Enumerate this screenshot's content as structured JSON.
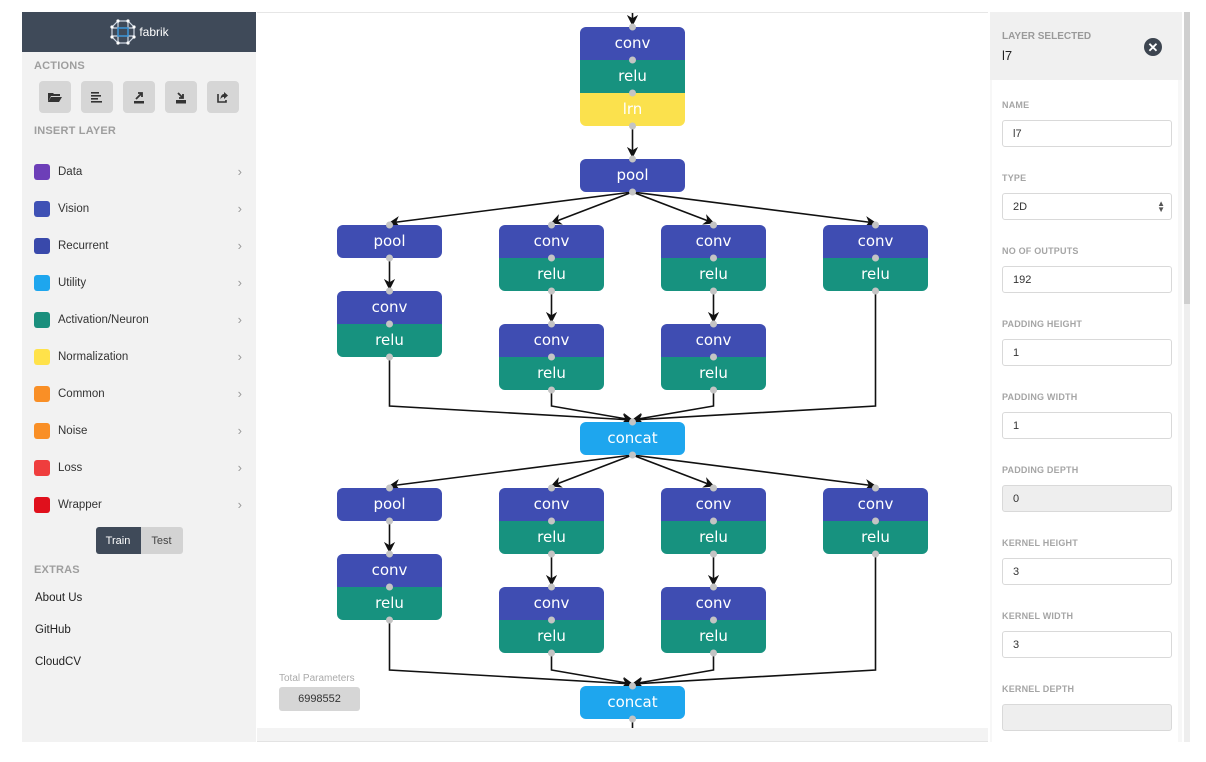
{
  "app": {
    "brand": "fabrik"
  },
  "sidebar": {
    "actions_title": "ACTIONS",
    "actions": [
      {
        "name": "open-icon",
        "tooltip": "open"
      },
      {
        "name": "list-icon",
        "tooltip": "list"
      },
      {
        "name": "export-icon",
        "tooltip": "export"
      },
      {
        "name": "import-icon",
        "tooltip": "import"
      },
      {
        "name": "share-icon",
        "tooltip": "share"
      }
    ],
    "insert_title": "INSERT LAYER",
    "layers": [
      {
        "label": "Data",
        "color": "#6d3fb8"
      },
      {
        "label": "Vision",
        "color": "#3f51b5"
      },
      {
        "label": "Recurrent",
        "color": "#3949ab"
      },
      {
        "label": "Utility",
        "color": "#1ea6ee"
      },
      {
        "label": "Activation/Neuron",
        "color": "#1a8f7d"
      },
      {
        "label": "Normalization",
        "color": "#ffe24a"
      },
      {
        "label": "Common",
        "color": "#f98f26"
      },
      {
        "label": "Noise",
        "color": "#f98f26"
      },
      {
        "label": "Loss",
        "color": "#ef3e3e"
      },
      {
        "label": "Wrapper",
        "color": "#e0101c"
      }
    ],
    "chevron": "›",
    "mode": {
      "train": "Train",
      "test": "Test",
      "active": "Train"
    },
    "extras_title": "EXTRAS",
    "extras": [
      "About Us",
      "GitHub",
      "CloudCV"
    ]
  },
  "canvas": {
    "total_params_label": "Total Parameters",
    "total_params_value": "6998552",
    "colors": {
      "vision": "#3f4db2",
      "activation": "#17927f",
      "normalization": "#fbe14d",
      "utility": "#1ea6ee",
      "port": "#c4c4c4"
    },
    "nodes": [
      {
        "id": "n_top",
        "sections": [
          {
            "label": "conv",
            "kind": "vision"
          },
          {
            "label": "relu",
            "kind": "activation"
          },
          {
            "label": "lrn",
            "kind": "normalization"
          }
        ]
      },
      {
        "id": "n_pool1",
        "sections": [
          {
            "label": "pool",
            "kind": "vision"
          }
        ]
      },
      {
        "id": "n_a1",
        "sections": [
          {
            "label": "pool",
            "kind": "vision"
          }
        ]
      },
      {
        "id": "n_b1",
        "sections": [
          {
            "label": "conv",
            "kind": "vision"
          },
          {
            "label": "relu",
            "kind": "activation"
          }
        ]
      },
      {
        "id": "n_c1",
        "sections": [
          {
            "label": "conv",
            "kind": "vision"
          },
          {
            "label": "relu",
            "kind": "activation"
          }
        ]
      },
      {
        "id": "n_d1",
        "sections": [
          {
            "label": "conv",
            "kind": "vision"
          },
          {
            "label": "relu",
            "kind": "activation"
          }
        ]
      },
      {
        "id": "n_a2",
        "sections": [
          {
            "label": "conv",
            "kind": "vision"
          },
          {
            "label": "relu",
            "kind": "activation"
          }
        ]
      },
      {
        "id": "n_b2",
        "sections": [
          {
            "label": "conv",
            "kind": "vision"
          },
          {
            "label": "relu",
            "kind": "activation"
          }
        ]
      },
      {
        "id": "n_c2",
        "sections": [
          {
            "label": "conv",
            "kind": "vision"
          },
          {
            "label": "relu",
            "kind": "activation"
          }
        ]
      },
      {
        "id": "n_concat1",
        "sections": [
          {
            "label": "concat",
            "kind": "utility"
          }
        ]
      },
      {
        "id": "n_a3",
        "sections": [
          {
            "label": "pool",
            "kind": "vision"
          }
        ]
      },
      {
        "id": "n_b3",
        "sections": [
          {
            "label": "conv",
            "kind": "vision"
          },
          {
            "label": "relu",
            "kind": "activation"
          }
        ]
      },
      {
        "id": "n_c3",
        "sections": [
          {
            "label": "conv",
            "kind": "vision"
          },
          {
            "label": "relu",
            "kind": "activation"
          }
        ]
      },
      {
        "id": "n_d3",
        "sections": [
          {
            "label": "conv",
            "kind": "vision"
          },
          {
            "label": "relu",
            "kind": "activation"
          }
        ]
      },
      {
        "id": "n_a4",
        "sections": [
          {
            "label": "conv",
            "kind": "vision"
          },
          {
            "label": "relu",
            "kind": "activation"
          }
        ]
      },
      {
        "id": "n_b4",
        "sections": [
          {
            "label": "conv",
            "kind": "vision"
          },
          {
            "label": "relu",
            "kind": "activation"
          }
        ]
      },
      {
        "id": "n_c4",
        "sections": [
          {
            "label": "conv",
            "kind": "vision"
          },
          {
            "label": "relu",
            "kind": "activation"
          }
        ]
      },
      {
        "id": "n_concat2",
        "sections": [
          {
            "label": "concat",
            "kind": "utility"
          }
        ]
      }
    ],
    "edges": [
      [
        "n_top",
        "n_pool1"
      ],
      [
        "n_pool1",
        "n_a1"
      ],
      [
        "n_pool1",
        "n_b1"
      ],
      [
        "n_pool1",
        "n_c1"
      ],
      [
        "n_pool1",
        "n_d1"
      ],
      [
        "n_a1",
        "n_a2"
      ],
      [
        "n_b1",
        "n_b2"
      ],
      [
        "n_c1",
        "n_c2"
      ],
      [
        "n_a2",
        "n_concat1"
      ],
      [
        "n_b2",
        "n_concat1"
      ],
      [
        "n_c2",
        "n_concat1"
      ],
      [
        "n_d1",
        "n_concat1"
      ],
      [
        "n_concat1",
        "n_a3"
      ],
      [
        "n_concat1",
        "n_b3"
      ],
      [
        "n_concat1",
        "n_c3"
      ],
      [
        "n_concat1",
        "n_d3"
      ],
      [
        "n_a3",
        "n_a4"
      ],
      [
        "n_b3",
        "n_b4"
      ],
      [
        "n_c3",
        "n_c4"
      ],
      [
        "n_a4",
        "n_concat2"
      ],
      [
        "n_b4",
        "n_concat2"
      ],
      [
        "n_c4",
        "n_concat2"
      ],
      [
        "n_d3",
        "n_concat2"
      ]
    ]
  },
  "panel": {
    "header_title": "LAYER SELECTED",
    "layer_name": "l7",
    "fields": [
      {
        "label": "NAME",
        "value": "l7",
        "type": "text",
        "disabled": false
      },
      {
        "label": "TYPE",
        "value": "2D",
        "type": "select",
        "disabled": false
      },
      {
        "label": "NO OF OUTPUTS",
        "value": "192",
        "type": "text",
        "disabled": false
      },
      {
        "label": "PADDING HEIGHT",
        "value": "1",
        "type": "text",
        "disabled": false
      },
      {
        "label": "PADDING WIDTH",
        "value": "1",
        "type": "text",
        "disabled": false
      },
      {
        "label": "PADDING DEPTH",
        "value": "0",
        "type": "text",
        "disabled": true
      },
      {
        "label": "KERNEL HEIGHT",
        "value": "3",
        "type": "text",
        "disabled": false
      },
      {
        "label": "KERNEL WIDTH",
        "value": "3",
        "type": "text",
        "disabled": false
      },
      {
        "label": "KERNEL DEPTH",
        "value": "",
        "type": "text",
        "disabled": true
      }
    ]
  }
}
